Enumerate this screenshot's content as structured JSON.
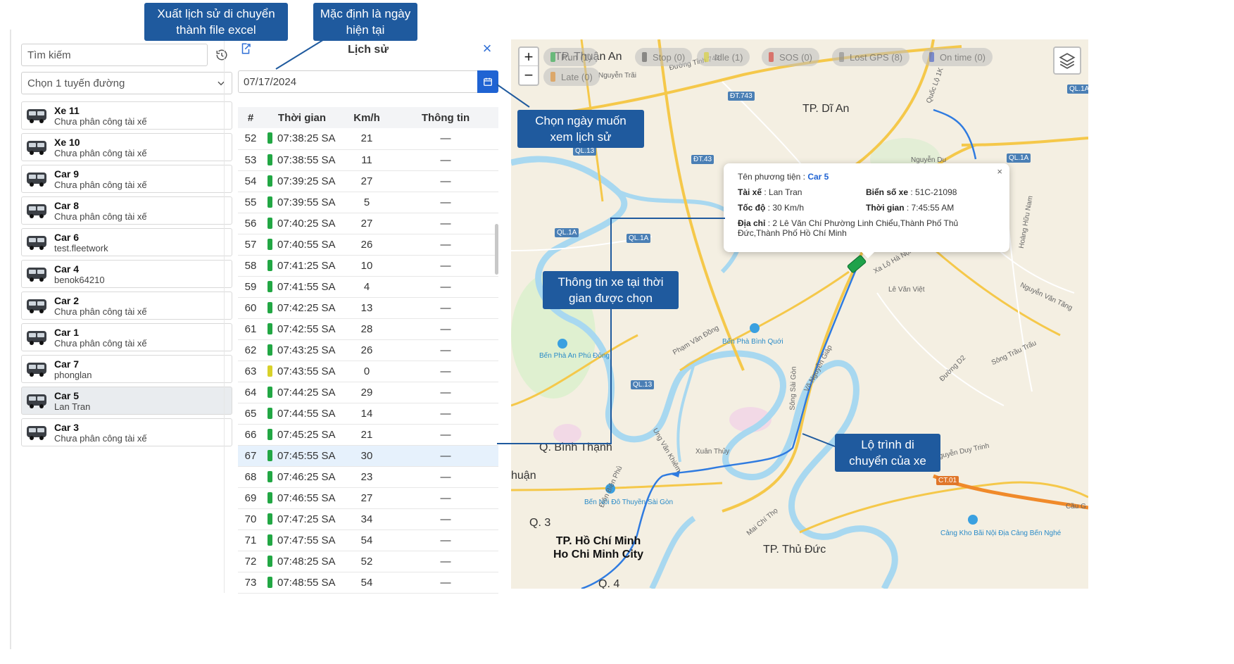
{
  "sidebar": {
    "search_placeholder": "Tìm kiếm",
    "route_select": "Chọn 1 tuyến đường",
    "vehicles": [
      {
        "name": "Xe 11",
        "sub": "Chưa phân công tài xế"
      },
      {
        "name": "Xe 10",
        "sub": "Chưa phân công tài xế"
      },
      {
        "name": "Car 9",
        "sub": "Chưa phân công tài xế"
      },
      {
        "name": "Car 8",
        "sub": "Chưa phân công tài xế"
      },
      {
        "name": "Car 6",
        "sub": "test.fleetwork"
      },
      {
        "name": "Car 4",
        "sub": "benok64210"
      },
      {
        "name": "Car 2",
        "sub": "Chưa phân công tài xế"
      },
      {
        "name": "Car 1",
        "sub": "Chưa phân công tài xế"
      },
      {
        "name": "Car 7",
        "sub": "phonglan"
      },
      {
        "name": "Car 5",
        "sub": "Lan Tran",
        "selected": true
      },
      {
        "name": "Car 3",
        "sub": "Chưa phân công tài xế"
      }
    ]
  },
  "history": {
    "title": "Lịch sử",
    "date_value": "07/17/2024",
    "columns": [
      "#",
      "Thời gian",
      "Km/h",
      "Thông tin"
    ],
    "rows": [
      {
        "n": "52",
        "time": "07:38:25 SA",
        "speed": "21",
        "info": "—"
      },
      {
        "n": "53",
        "time": "07:38:55 SA",
        "speed": "11",
        "info": "—"
      },
      {
        "n": "54",
        "time": "07:39:25 SA",
        "speed": "27",
        "info": "—"
      },
      {
        "n": "55",
        "time": "07:39:55 SA",
        "speed": "5",
        "info": "—"
      },
      {
        "n": "56",
        "time": "07:40:25 SA",
        "speed": "27",
        "info": "—"
      },
      {
        "n": "57",
        "time": "07:40:55 SA",
        "speed": "26",
        "info": "—"
      },
      {
        "n": "58",
        "time": "07:41:25 SA",
        "speed": "10",
        "info": "—"
      },
      {
        "n": "59",
        "time": "07:41:55 SA",
        "speed": "4",
        "info": "—"
      },
      {
        "n": "60",
        "time": "07:42:25 SA",
        "speed": "13",
        "info": "—"
      },
      {
        "n": "61",
        "time": "07:42:55 SA",
        "speed": "28",
        "info": "—"
      },
      {
        "n": "62",
        "time": "07:43:25 SA",
        "speed": "26",
        "info": "—"
      },
      {
        "n": "63",
        "time": "07:43:55 SA",
        "speed": "0",
        "info": "—",
        "status": "idle"
      },
      {
        "n": "64",
        "time": "07:44:25 SA",
        "speed": "29",
        "info": "—"
      },
      {
        "n": "65",
        "time": "07:44:55 SA",
        "speed": "14",
        "info": "—"
      },
      {
        "n": "66",
        "time": "07:45:25 SA",
        "speed": "21",
        "info": "—"
      },
      {
        "n": "67",
        "time": "07:45:55 SA",
        "speed": "30",
        "info": "—",
        "selected": true
      },
      {
        "n": "68",
        "time": "07:46:25 SA",
        "speed": "23",
        "info": "—"
      },
      {
        "n": "69",
        "time": "07:46:55 SA",
        "speed": "27",
        "info": "—"
      },
      {
        "n": "70",
        "time": "07:47:25 SA",
        "speed": "34",
        "info": "—"
      },
      {
        "n": "71",
        "time": "07:47:55 SA",
        "speed": "54",
        "info": "—"
      },
      {
        "n": "72",
        "time": "07:48:25 SA",
        "speed": "52",
        "info": "—"
      },
      {
        "n": "73",
        "time": "07:48:55 SA",
        "speed": "54",
        "info": "—"
      }
    ]
  },
  "map": {
    "chips": [
      {
        "label": "Run (1)",
        "color": "#22a744"
      },
      {
        "label": "Stop (0)",
        "color": "#555555"
      },
      {
        "label": "Idle (1)",
        "color": "#d8d12a"
      },
      {
        "label": "SOS (0)",
        "color": "#d9342b"
      },
      {
        "label": "Lost GPS (8)",
        "color": "#888888"
      },
      {
        "label": "On time (0)",
        "color": "#3a56c9"
      },
      {
        "label": "Late (0)",
        "color": "#e08a2a"
      }
    ],
    "places": {
      "thuan_an": "TP. Thuận An",
      "di_an": "TP. Dĩ An",
      "binh_thanh": "Q. Bình Thạnh",
      "q3": "Q. 3",
      "thuan": "huận",
      "hcm_1": "TP. Hồ Chí Minh",
      "hcm_2": "Ho Chi Minh City",
      "thu_duc": "TP. Thủ Đức",
      "q4": "Q. 4"
    },
    "road_labels": [
      "QL.13",
      "ĐT.743",
      "ĐT.43",
      "QL.1A",
      "QL.1A",
      "QL.1A",
      "QL.1A",
      "QL.13",
      "CT.01",
      "ĐT.743B"
    ],
    "street_labels": [
      "Đường Tỉnh 743",
      "Nguyễn Trãi",
      "Quốc Lộ 1K",
      "Nguyễn Du",
      "Xa Lộ Hà Nội",
      "Võ Nguyễn Giáp",
      "Phạm Văn Đồng",
      "Bình Quới",
      "Sông Sài Gòn",
      "Ung Văn Khiêm",
      "Xuân Thủy",
      "Điện Biên Phủ",
      "Mai Chí Thọ",
      "Nguyễn Duy Trinh",
      "Đường D2",
      "Song Hành",
      "Sông Trầu Trấu",
      "Lê Văn Việt",
      "Lã Xuân Oai",
      "Quang Trung",
      "Đặng Văn Bi",
      "Kha Vạn Cân",
      "Hoàng Hữu Nam",
      "Lê Văn Việt",
      "Nguyễn Văn Tăng",
      "Tân Vạn",
      "Trần Não",
      "Cầu G"
    ],
    "ferry_labels": [
      "Bến Phà An Phú Đông",
      "Bến Phà Bình Quới",
      "Bến Nối Đô Thuyền Sài Gòn",
      "Cảng Kho Bãi Nội Địa Cảng Bến Nghé"
    ],
    "popup": {
      "vehicle_label": "Tên phương tiện",
      "vehicle_value": "Car 5",
      "driver_label": "Tài xế",
      "driver_value": "Lan Tran",
      "plate_label": "Biển số xe",
      "plate_value": "51C-21098",
      "speed_label": "Tốc độ",
      "speed_value": "30 Km/h",
      "time_label": "Thời gian",
      "time_value": "7:45:55 AM",
      "address_label": "Địa chỉ",
      "address_value": "2 Lê Văn Chí Phường Linh Chiểu,Thành Phố Thủ Đức,Thành Phố Hồ Chí Minh"
    }
  },
  "callouts": {
    "export": "Xuất lịch sử di chuyển thành file excel",
    "default_date": "Mặc định là ngày hiện tại",
    "pick_date": "Chọn ngày muốn xem lịch sử",
    "vehicle_info": "Thông tin xe tại thời gian được chọn",
    "route": "Lộ trình di chuyển của xe"
  },
  "colors": {
    "accent": "#1f63d3",
    "callout_bg": "#1f5a9e",
    "run": "#22a744",
    "idle": "#d8d12a",
    "route": "#2f7be0"
  }
}
